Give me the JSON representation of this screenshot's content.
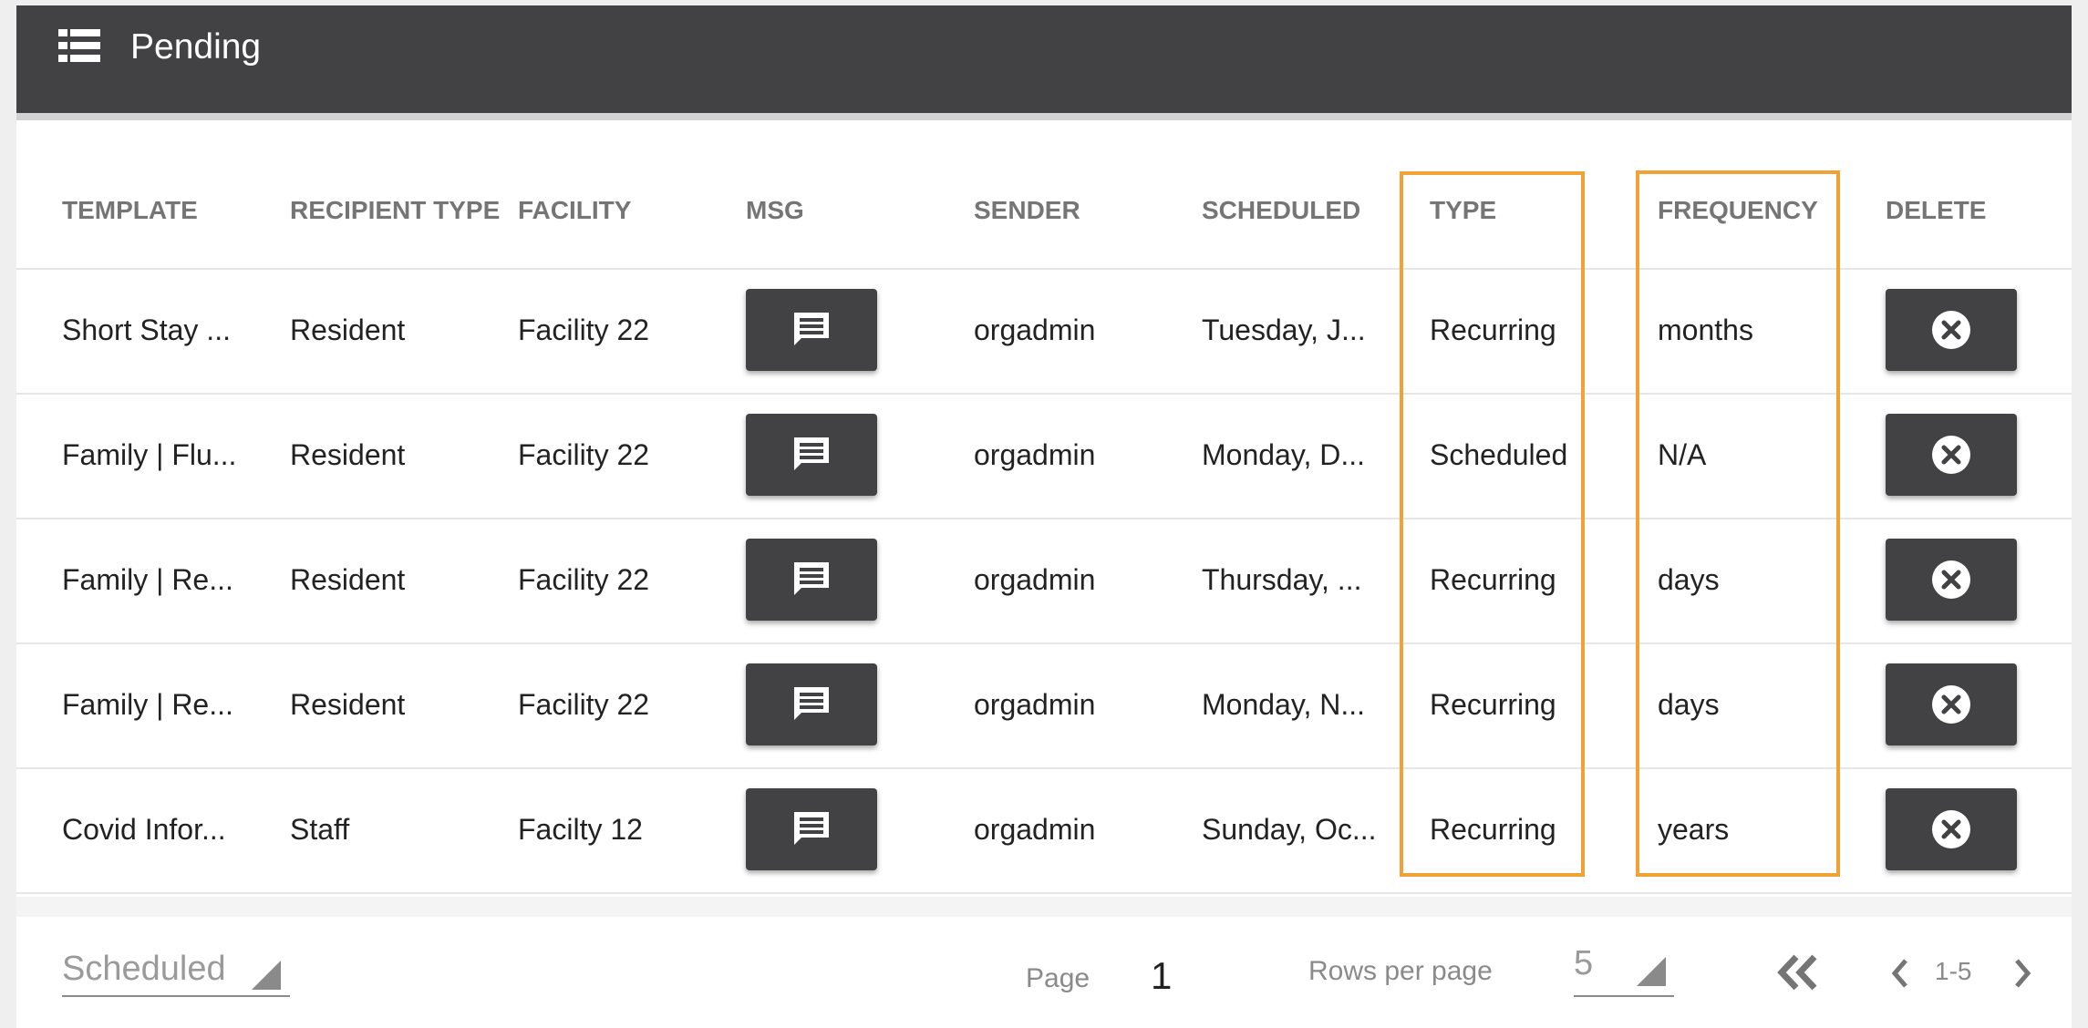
{
  "header": {
    "title": "Pending",
    "icon": "list-icon"
  },
  "table": {
    "columns": [
      "TEMPLATE",
      "RECIPIENT TYPE",
      "FACILITY",
      "MSG",
      "SENDER",
      "SCHEDULED",
      "TYPE",
      "FREQUENCY",
      "DELETE"
    ],
    "rows": [
      {
        "template": "Short Stay ...",
        "recipient_type": "Resident",
        "facility": "Facility 22",
        "sender": "orgadmin",
        "scheduled": "Tuesday, J...",
        "type": "Recurring",
        "frequency": "months"
      },
      {
        "template": "Family | Flu...",
        "recipient_type": "Resident",
        "facility": "Facility 22",
        "sender": "orgadmin",
        "scheduled": "Monday, D...",
        "type": "Scheduled",
        "frequency": "N/A"
      },
      {
        "template": "Family | Re...",
        "recipient_type": "Resident",
        "facility": "Facility 22",
        "sender": "orgadmin",
        "scheduled": "Thursday, ...",
        "type": "Recurring",
        "frequency": "days"
      },
      {
        "template": "Family | Re...",
        "recipient_type": "Resident",
        "facility": "Facility 22",
        "sender": "orgadmin",
        "scheduled": "Monday, N...",
        "type": "Recurring",
        "frequency": "days"
      },
      {
        "template": "Covid Infor...",
        "recipient_type": "Staff",
        "facility": "Facilty 12",
        "sender": "orgadmin",
        "scheduled": "Sunday, Oc...",
        "type": "Recurring",
        "frequency": "years"
      }
    ]
  },
  "footer": {
    "filter_value": "Scheduled",
    "page_label": "Page",
    "page_number": "1",
    "rows_per_page_label": "Rows per page",
    "rows_per_page_value": "5",
    "range": "1-5"
  },
  "colors": {
    "header_bg": "#424244",
    "button_bg": "#424244",
    "highlight": "#f0a236",
    "header_text": "#757575"
  }
}
